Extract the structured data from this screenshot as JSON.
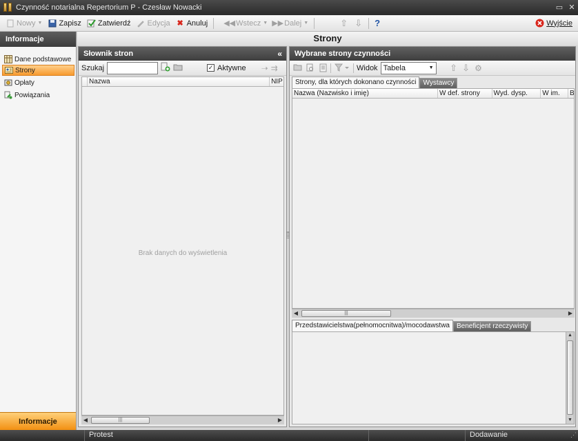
{
  "window": {
    "title": "Czynność notarialna Repertorium P - Czesław Nowacki",
    "minimize": "▭",
    "close": "✕"
  },
  "toolbar": {
    "new_label": "Nowy",
    "save_label": "Zapisz",
    "approve_label": "Zatwierdź",
    "edit_label": "Edycja",
    "cancel_label": "Anuluj",
    "back_label": "Wstecz",
    "next_label": "Dalej",
    "help_label": "?",
    "exit_label": "Wyjście"
  },
  "nav": {
    "header": "Informacje",
    "items": [
      {
        "label": "Dane podstawowe",
        "icon": "table-icon",
        "active": false
      },
      {
        "label": "Strony",
        "icon": "person-card-icon",
        "active": true
      },
      {
        "label": "Opłaty",
        "icon": "coins-icon",
        "active": false
      },
      {
        "label": "Powiązania",
        "icon": "link-icon",
        "active": false
      }
    ],
    "footer": "Informacje"
  },
  "page_title": "Strony",
  "left_panel": {
    "title": "Słownik stron",
    "collapse": "«",
    "search_label": "Szukaj",
    "search_value": "",
    "active_label": "Aktywne",
    "active_checked": true,
    "columns": [
      "Nazwa",
      "NIP"
    ],
    "empty_message": "Brak danych do wyświetlenia"
  },
  "right_panel": {
    "title": "Wybrane strony czynności",
    "view_label": "Widok",
    "view_value": "Tabela",
    "tabs_top": [
      "Strony, dla których dokonano czynności",
      "Wystawcy"
    ],
    "columns": [
      "Nazwa (Nazwisko i imię)",
      "W def. strony",
      "Wyd. dysp.",
      "W im.",
      "B"
    ],
    "tabs_bottom": [
      "Przedstawicielstwa(pełnomocnitwa)/mocodawstwa",
      "Beneficjent rzeczywisty"
    ]
  },
  "status": {
    "item1": "Protest",
    "item2": "Dodawanie"
  },
  "colors": {
    "accent": "#f79a2e",
    "header_dark": "#3e3e3e"
  }
}
